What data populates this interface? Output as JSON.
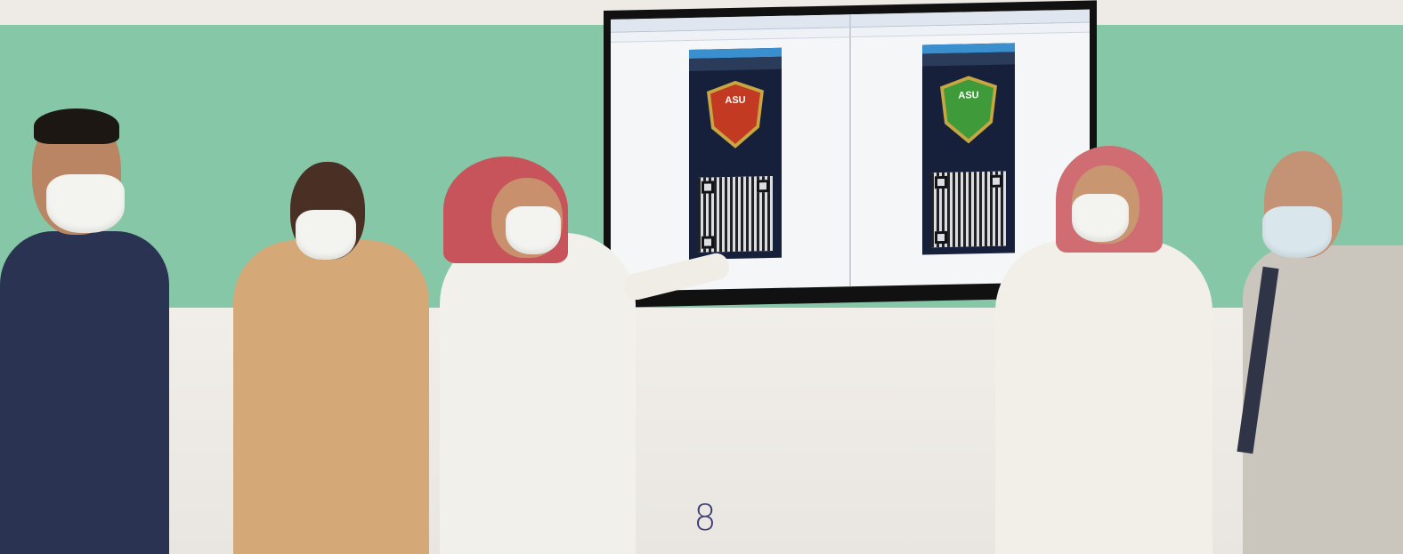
{
  "page_number": "8",
  "screen": {
    "left_badge_text": "ASU",
    "right_badge_text": "ASU",
    "left_status_color": "#c23a22",
    "right_status_color": "#3f9a3a"
  },
  "colors": {
    "band": "#86c7a8",
    "page_number": "#3b3a76"
  }
}
